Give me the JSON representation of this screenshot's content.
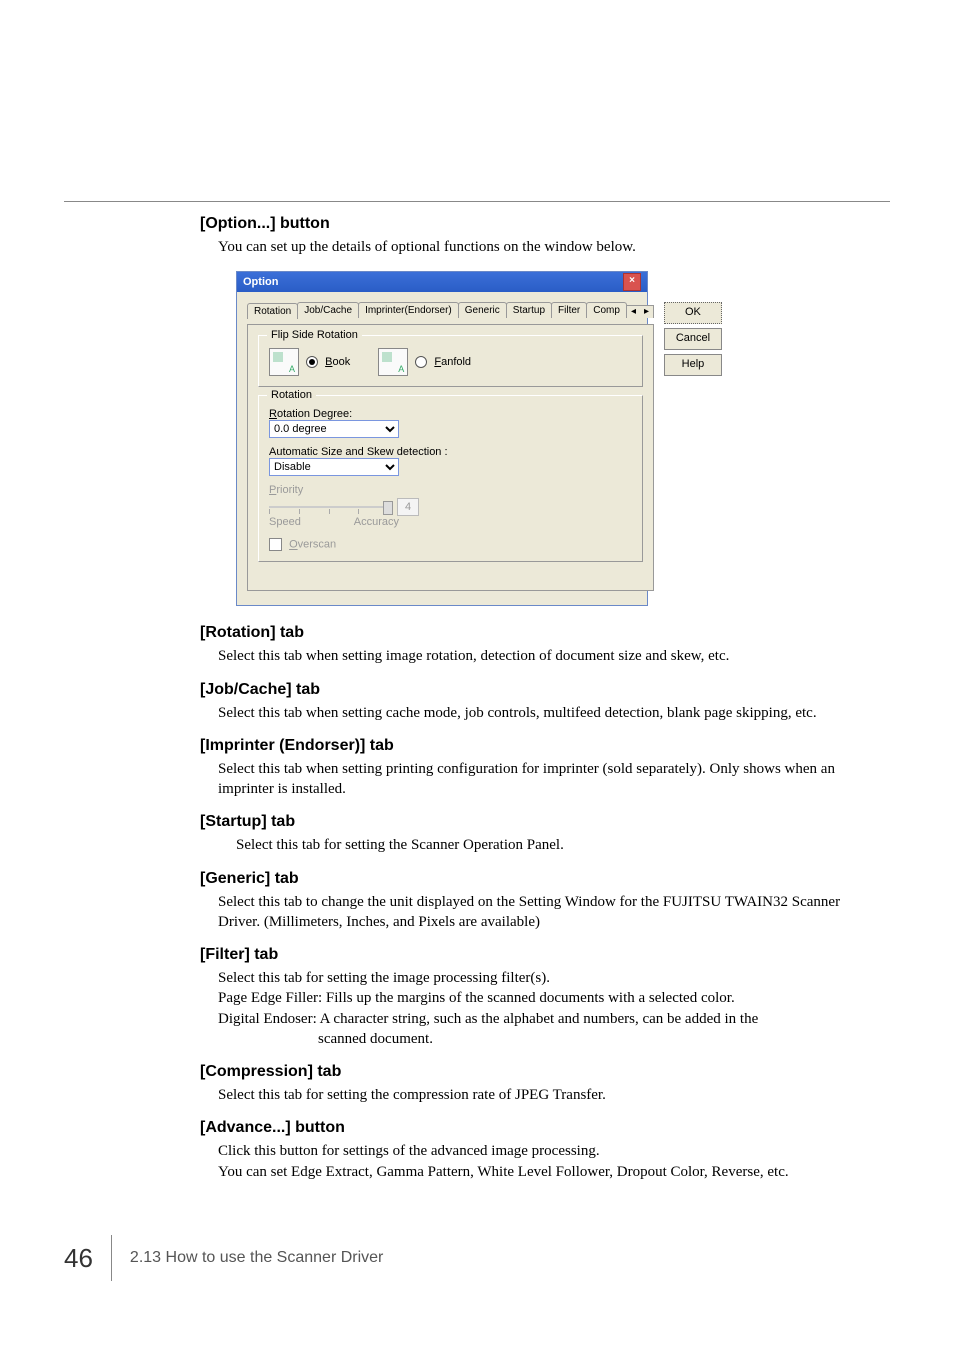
{
  "sections": {
    "option": {
      "heading": "[Option...] button",
      "text": "You can set up the details of optional functions on the window below."
    },
    "rotation": {
      "heading": "[Rotation] tab",
      "text": "Select this tab when setting image rotation, detection of document size and skew, etc."
    },
    "jobcache": {
      "heading": "[Job/Cache] tab",
      "text": "Select this tab when setting cache mode, job controls, multifeed detection, blank page skipping, etc."
    },
    "imprinter": {
      "heading": "[Imprinter (Endorser)] tab",
      "text": "Select this tab when setting printing configuration for imprinter (sold separately). Only shows when an imprinter is installed."
    },
    "startup": {
      "heading": "[Startup] tab",
      "text": "Select this tab for setting the Scanner Operation Panel."
    },
    "generic": {
      "heading": "[Generic] tab",
      "text": "Select this tab to change the unit displayed on the Setting Window for the FUJITSU TWAIN32 Scanner Driver. (Millimeters, Inches, and Pixels are available)"
    },
    "filter": {
      "heading": "[Filter] tab",
      "l1": "Select this tab for setting the image processing filter(s).",
      "l2": "Page Edge Filler: Fills up the margins of the scanned documents with a selected color.",
      "l3": "Digital Endoser: A character string, such as the alphabet and numbers, can be added in the",
      "l3b": "scanned document."
    },
    "compression": {
      "heading": "[Compression] tab",
      "text": "Select this tab for setting the compression rate of JPEG Transfer."
    },
    "advance": {
      "heading": "[Advance...] button",
      "l1": "Click this button for settings of the advanced image processing.",
      "l2": "You can set Edge Extract, Gamma Pattern, White Level Follower, Dropout Color, Reverse, etc."
    }
  },
  "dialog": {
    "title": "Option",
    "tabs": [
      "Rotation",
      "Job/Cache",
      "Imprinter(Endorser)",
      "Generic",
      "Startup",
      "Filter",
      "Comp"
    ],
    "scroll_left": "◂",
    "scroll_right": "▸",
    "buttons": {
      "ok": "OK",
      "cancel": "Cancel",
      "help": "Help"
    },
    "flip": {
      "group": "Flip Side Rotation",
      "book": "Book",
      "book_key": "B",
      "fanfold": "Fanfold",
      "fanfold_key": "F"
    },
    "rot": {
      "group": "Rotation",
      "degree_label": "Rotation Degree:",
      "degree_key": "R",
      "degree_value": "0.0 degree",
      "auto_label": "Automatic Size and Skew detection :",
      "auto_value": "Disable",
      "priority_label": "Priority",
      "priority_key": "P",
      "priority_value": "4",
      "speed": "Speed",
      "accuracy": "Accuracy",
      "overscan": "Overscan",
      "overscan_key": "O"
    }
  },
  "footer": {
    "page": "46",
    "text": "2.13 How to use the Scanner Driver"
  }
}
